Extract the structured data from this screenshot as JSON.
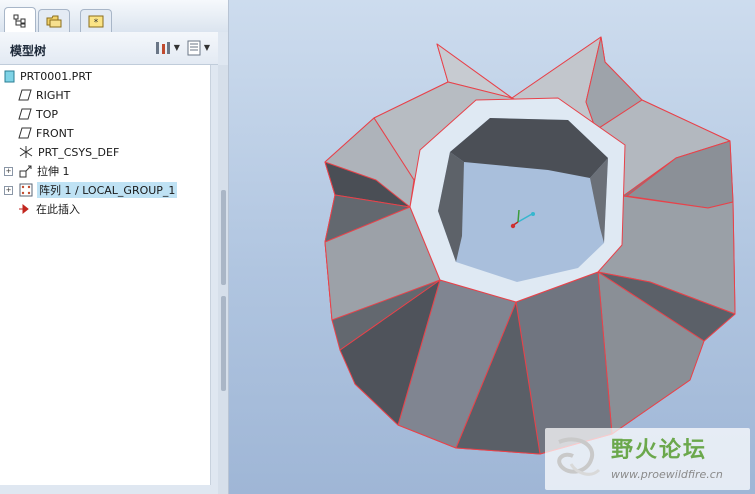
{
  "tabs": [
    {
      "icon": "model-tree-tab-icon",
      "active": true
    },
    {
      "icon": "folder-browser-tab-icon",
      "active": false
    },
    {
      "icon": "favorites-tab-icon",
      "active": false
    }
  ],
  "model_tree": {
    "title": "模型树",
    "tools": [
      {
        "icon": "tree-settings-icon"
      },
      {
        "icon": "tree-columns-icon"
      }
    ],
    "items": [
      {
        "label": "PRT0001.PRT",
        "icon": "part-icon"
      },
      {
        "label": "RIGHT",
        "icon": "datum-plane-icon"
      },
      {
        "label": "TOP",
        "icon": "datum-plane-icon"
      },
      {
        "label": "FRONT",
        "icon": "datum-plane-icon"
      },
      {
        "label": "PRT_CSYS_DEF",
        "icon": "coordinate-system-icon"
      },
      {
        "label": "拉伸 1",
        "icon": "extrude-icon"
      },
      {
        "label": "阵列 1 / LOCAL_GROUP_1",
        "icon": "pattern-icon"
      },
      {
        "label": "在此插入",
        "icon": "insert-here-arrow-icon"
      }
    ]
  },
  "watermark": {
    "title": "野火论坛",
    "url": "www.proewildfire.cn"
  },
  "colors": {
    "edge_highlight": "#e8424a",
    "face_light": "#b9bdc3",
    "face_dark": "#5f646b",
    "viewport_top": "#cddcee",
    "viewport_bottom": "#9fb6d6"
  }
}
